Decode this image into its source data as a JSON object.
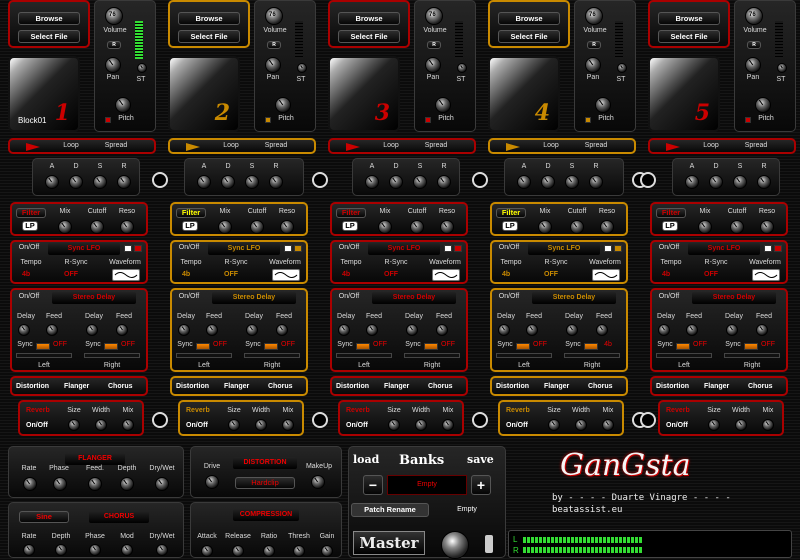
{
  "columns": [
    {
      "number": "1",
      "accent": "red",
      "block_name": "Block01"
    },
    {
      "number": "2",
      "accent": "yellow",
      "block_name": ""
    },
    {
      "number": "3",
      "accent": "red",
      "block_name": ""
    },
    {
      "number": "4",
      "accent": "yellow",
      "block_name": ""
    },
    {
      "number": "5",
      "accent": "red",
      "block_name": ""
    }
  ],
  "file": {
    "browse": "Browse",
    "select": "Select File"
  },
  "mixer": {
    "volume": "Volume",
    "pan": "Pan",
    "st": "ST",
    "pitch": "Pitch",
    "r": "R",
    "knob_value": "76"
  },
  "loop": {
    "loop": "Loop",
    "spread": "Spread"
  },
  "adsr": [
    "A",
    "D",
    "S",
    "R"
  ],
  "filter": {
    "label": "Filter",
    "type": "LP",
    "mix": "Mix",
    "cutoff": "Cutoff",
    "reso": "Reso"
  },
  "lfo": {
    "onoff": "On/Off",
    "name": "Sync LFO",
    "tempo": "Tempo",
    "rsync": "R-Sync",
    "waveform": "Waveform",
    "tempo_val": "4b",
    "off": "OFF"
  },
  "delay": {
    "onoff": "On/Off",
    "name": "Stereo Delay",
    "delay": "Delay",
    "feed": "Feed",
    "sync": "Sync",
    "off": "OFF",
    "left": "Left",
    "right": "Right",
    "right_sync_values": [
      "OFF",
      "OFF",
      "OFF",
      "4b",
      "OFF"
    ]
  },
  "fx": {
    "distortion": "Distortion",
    "flanger": "Flanger",
    "chorus": "Chorus"
  },
  "reverb": {
    "label": "Reverb",
    "onoff": "On/Off",
    "size": "Size",
    "width": "Width",
    "mix": "Mix"
  },
  "flanger": {
    "title": "FLANGER",
    "rate": "Rate",
    "phase": "Phase",
    "feed": "Feed.",
    "depth": "Depth",
    "drywet": "Dry/Wet"
  },
  "chorus": {
    "title": "CHORUS",
    "sine": "Sine",
    "rate": "Rate",
    "depth": "Depth",
    "phase": "Phase",
    "mod": "Mod",
    "drywet": "Dry/Wet"
  },
  "distortion": {
    "title": "DISTORTION",
    "drive": "Drive",
    "makeup": "MakeUp",
    "type": "Hardclip"
  },
  "compression": {
    "title": "COMPRESSION",
    "attack": "Attack",
    "release": "Release",
    "ratio": "Ratio",
    "thresh": "Thresh",
    "gain": "Gain"
  },
  "banks": {
    "load": "load",
    "title": "Banks",
    "save": "save",
    "minus": "−",
    "plus": "+",
    "value": "Empty",
    "patch_rename": "Patch Rename",
    "patch_value": "Empty"
  },
  "master": {
    "label": "Master",
    "l": "L",
    "r": "R"
  },
  "brand": {
    "title": "GanGsta",
    "by": "by - - - - Duarte Vinagre - - - -",
    "url": "beatassist.eu"
  },
  "colors": {
    "red": "#cc0000",
    "yellow": "#c98a00",
    "green": "#33dd33"
  }
}
